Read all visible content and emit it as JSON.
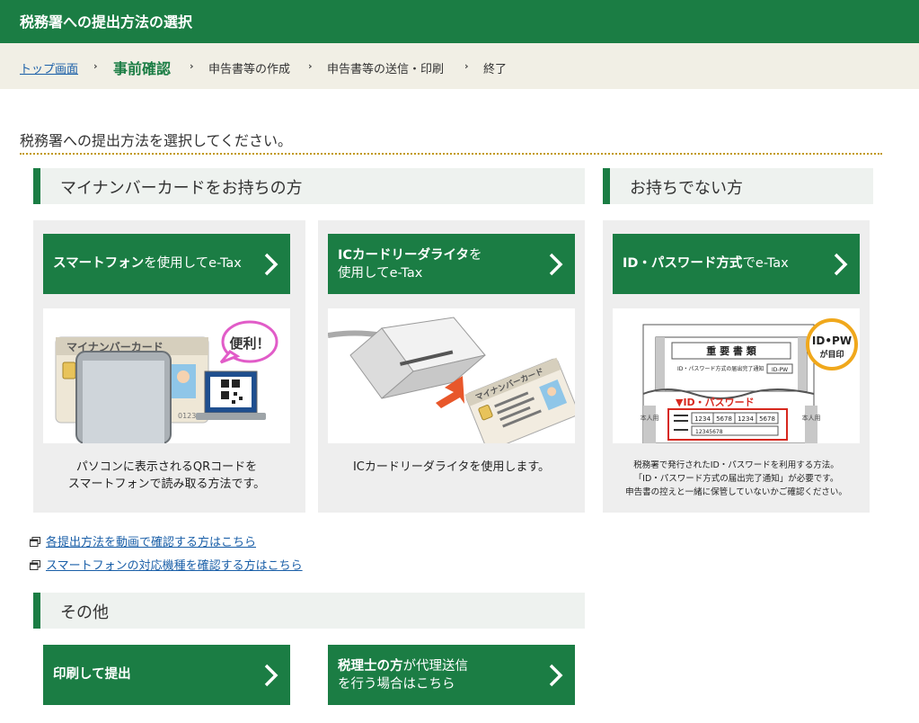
{
  "header": {
    "title": "税務署への提出方法の選択"
  },
  "breadcrumb": {
    "items": [
      {
        "label": "トップ画面"
      },
      {
        "label": "事前確認"
      },
      {
        "label": "申告書等の作成"
      },
      {
        "label": "申告書等の送信・印刷"
      },
      {
        "label": "終了"
      }
    ],
    "separator": "›"
  },
  "intro": "税務署への提出方法を選択してください。",
  "sections": {
    "mynumber": {
      "title": "マイナンバーカードをお持ちの方"
    },
    "no_card": {
      "title": "お持ちでない方"
    },
    "other": {
      "title": "その他"
    }
  },
  "options": {
    "smartphone": {
      "bold": "スマートフォン",
      "rest": "を使用してe-Tax",
      "desc_line1": "パソコンに表示されるQRコードを",
      "desc_line2": "スマートフォンで読み取る方法です。",
      "ill_card_label": "マイナンバーカード",
      "ill_bubble": "便利！",
      "ill_card_code": "012345"
    },
    "icreader": {
      "bold": "ICカードリーダライタ",
      "rest1": "を",
      "line2": "使用してe-Tax",
      "desc": "ICカードリーダライタを使用します。",
      "ill_card_label": "マイナンバーカード"
    },
    "idpw": {
      "bold": "ID・パスワード方式",
      "rest": "でe-Tax",
      "desc_line1": "税務署で発行されたID・パスワードを利用する方法。",
      "desc_line2": "「ID・パスワード方式の届出完了通知」が必要です。",
      "desc_line3": "申告書の控えと一緒に保管していないかご確認ください。",
      "ill_doc_title": "重 要 書 類",
      "ill_doc_sub": "ID・パスワード方式の届出完了通知",
      "ill_badge_top": "ID-PW",
      "ill_badge_line1": "ID•PW",
      "ill_badge_line2": "が目印",
      "ill_red_label": "▼ID・パスワード",
      "ill_id_cells": [
        "1234",
        "5678",
        "1234",
        "5678"
      ],
      "ill_pw": "12345678",
      "ill_side_mark": "用 本人",
      "ill_side_left": "本人用",
      "ill_side_right": "本人用"
    },
    "print": {
      "label": "印刷して提出"
    },
    "tax_accountant": {
      "bold": "税理士の方",
      "rest1": "が代理送信",
      "line2": "を行う場合はこちら"
    }
  },
  "links": [
    {
      "label": "各提出方法を動画で確認する方はこちら"
    },
    {
      "label": "スマートフォンの対応機種を確認する方はこちら"
    }
  ],
  "colors": {
    "brand_green": "#1b7d44",
    "breadcrumb_bg": "#f1efe5",
    "panel_bg": "#eeeeee",
    "link_blue": "#1a5fa8",
    "divider_gold": "#c29a19"
  }
}
